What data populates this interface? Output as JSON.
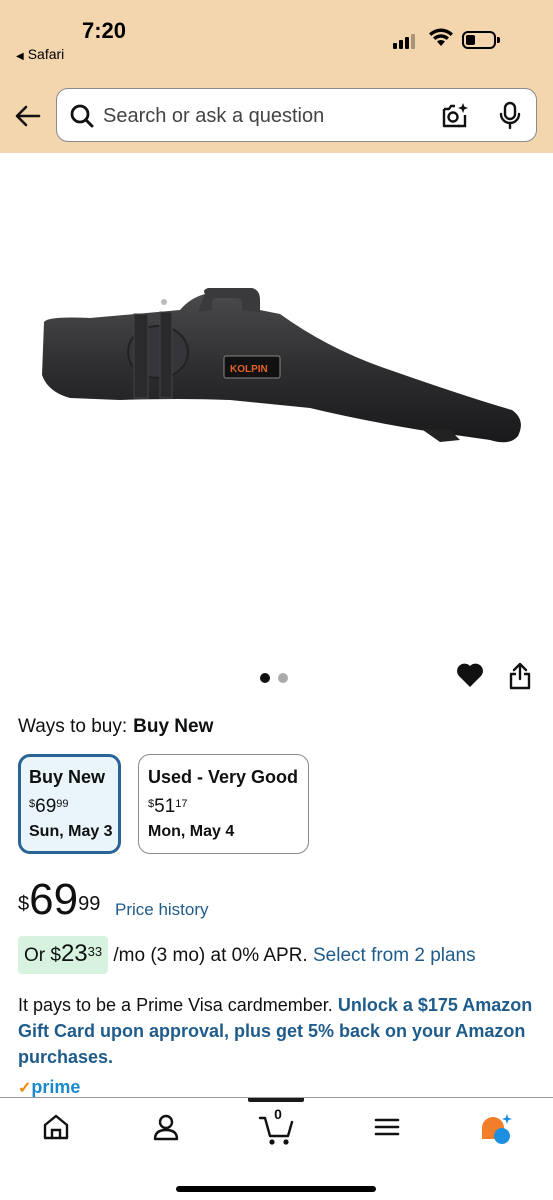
{
  "status_bar": {
    "time": "7:20",
    "back_app": "Safari",
    "icons": [
      "signal-icon",
      "wifi-icon",
      "battery-icon"
    ]
  },
  "header": {
    "search_placeholder": "Search or ask a question",
    "icons": [
      "back-arrow-icon",
      "search-icon",
      "camera-icon",
      "mic-icon"
    ]
  },
  "product": {
    "image_label": "KOLPIN",
    "carousel": {
      "pages": 2,
      "current": 1
    }
  },
  "ways_to_buy": {
    "label": "Ways to buy:",
    "selected": "Buy New",
    "options": [
      {
        "title": "Buy New",
        "currency": "$",
        "price_whole": "69",
        "price_cents": "99",
        "date": "Sun, May 3"
      },
      {
        "title": "Used - Very Good",
        "currency": "$",
        "price_whole": "51",
        "price_cents": "17",
        "date": "Mon, May 4"
      }
    ]
  },
  "price": {
    "currency": "$",
    "whole": "69",
    "cents": "99",
    "history_link": "Price history"
  },
  "financing": {
    "prefix": "Or $",
    "monthly_whole": "23",
    "monthly_cents": "33",
    "suffix": "/mo (3 mo) at 0% APR.",
    "link": "Select from 2 plans"
  },
  "prime_visa": {
    "text": "It pays to be a Prime Visa cardmember.",
    "cta": "Unlock a $175 Amazon Gift Card upon approval, plus get 5% back on your Amazon purchases."
  },
  "prime_badge": "prime",
  "bottom_nav": {
    "cart_count": "0",
    "items": [
      "home-icon",
      "account-icon",
      "cart-icon",
      "menu-icon",
      "rufus-icon"
    ]
  },
  "colors": {
    "header_bg": "#f3d6ae",
    "link": "#1f5c8b",
    "selected_border": "#2a6496",
    "apr_highlight": "#d8f2e0",
    "prime_blue": "#1a8acb"
  }
}
